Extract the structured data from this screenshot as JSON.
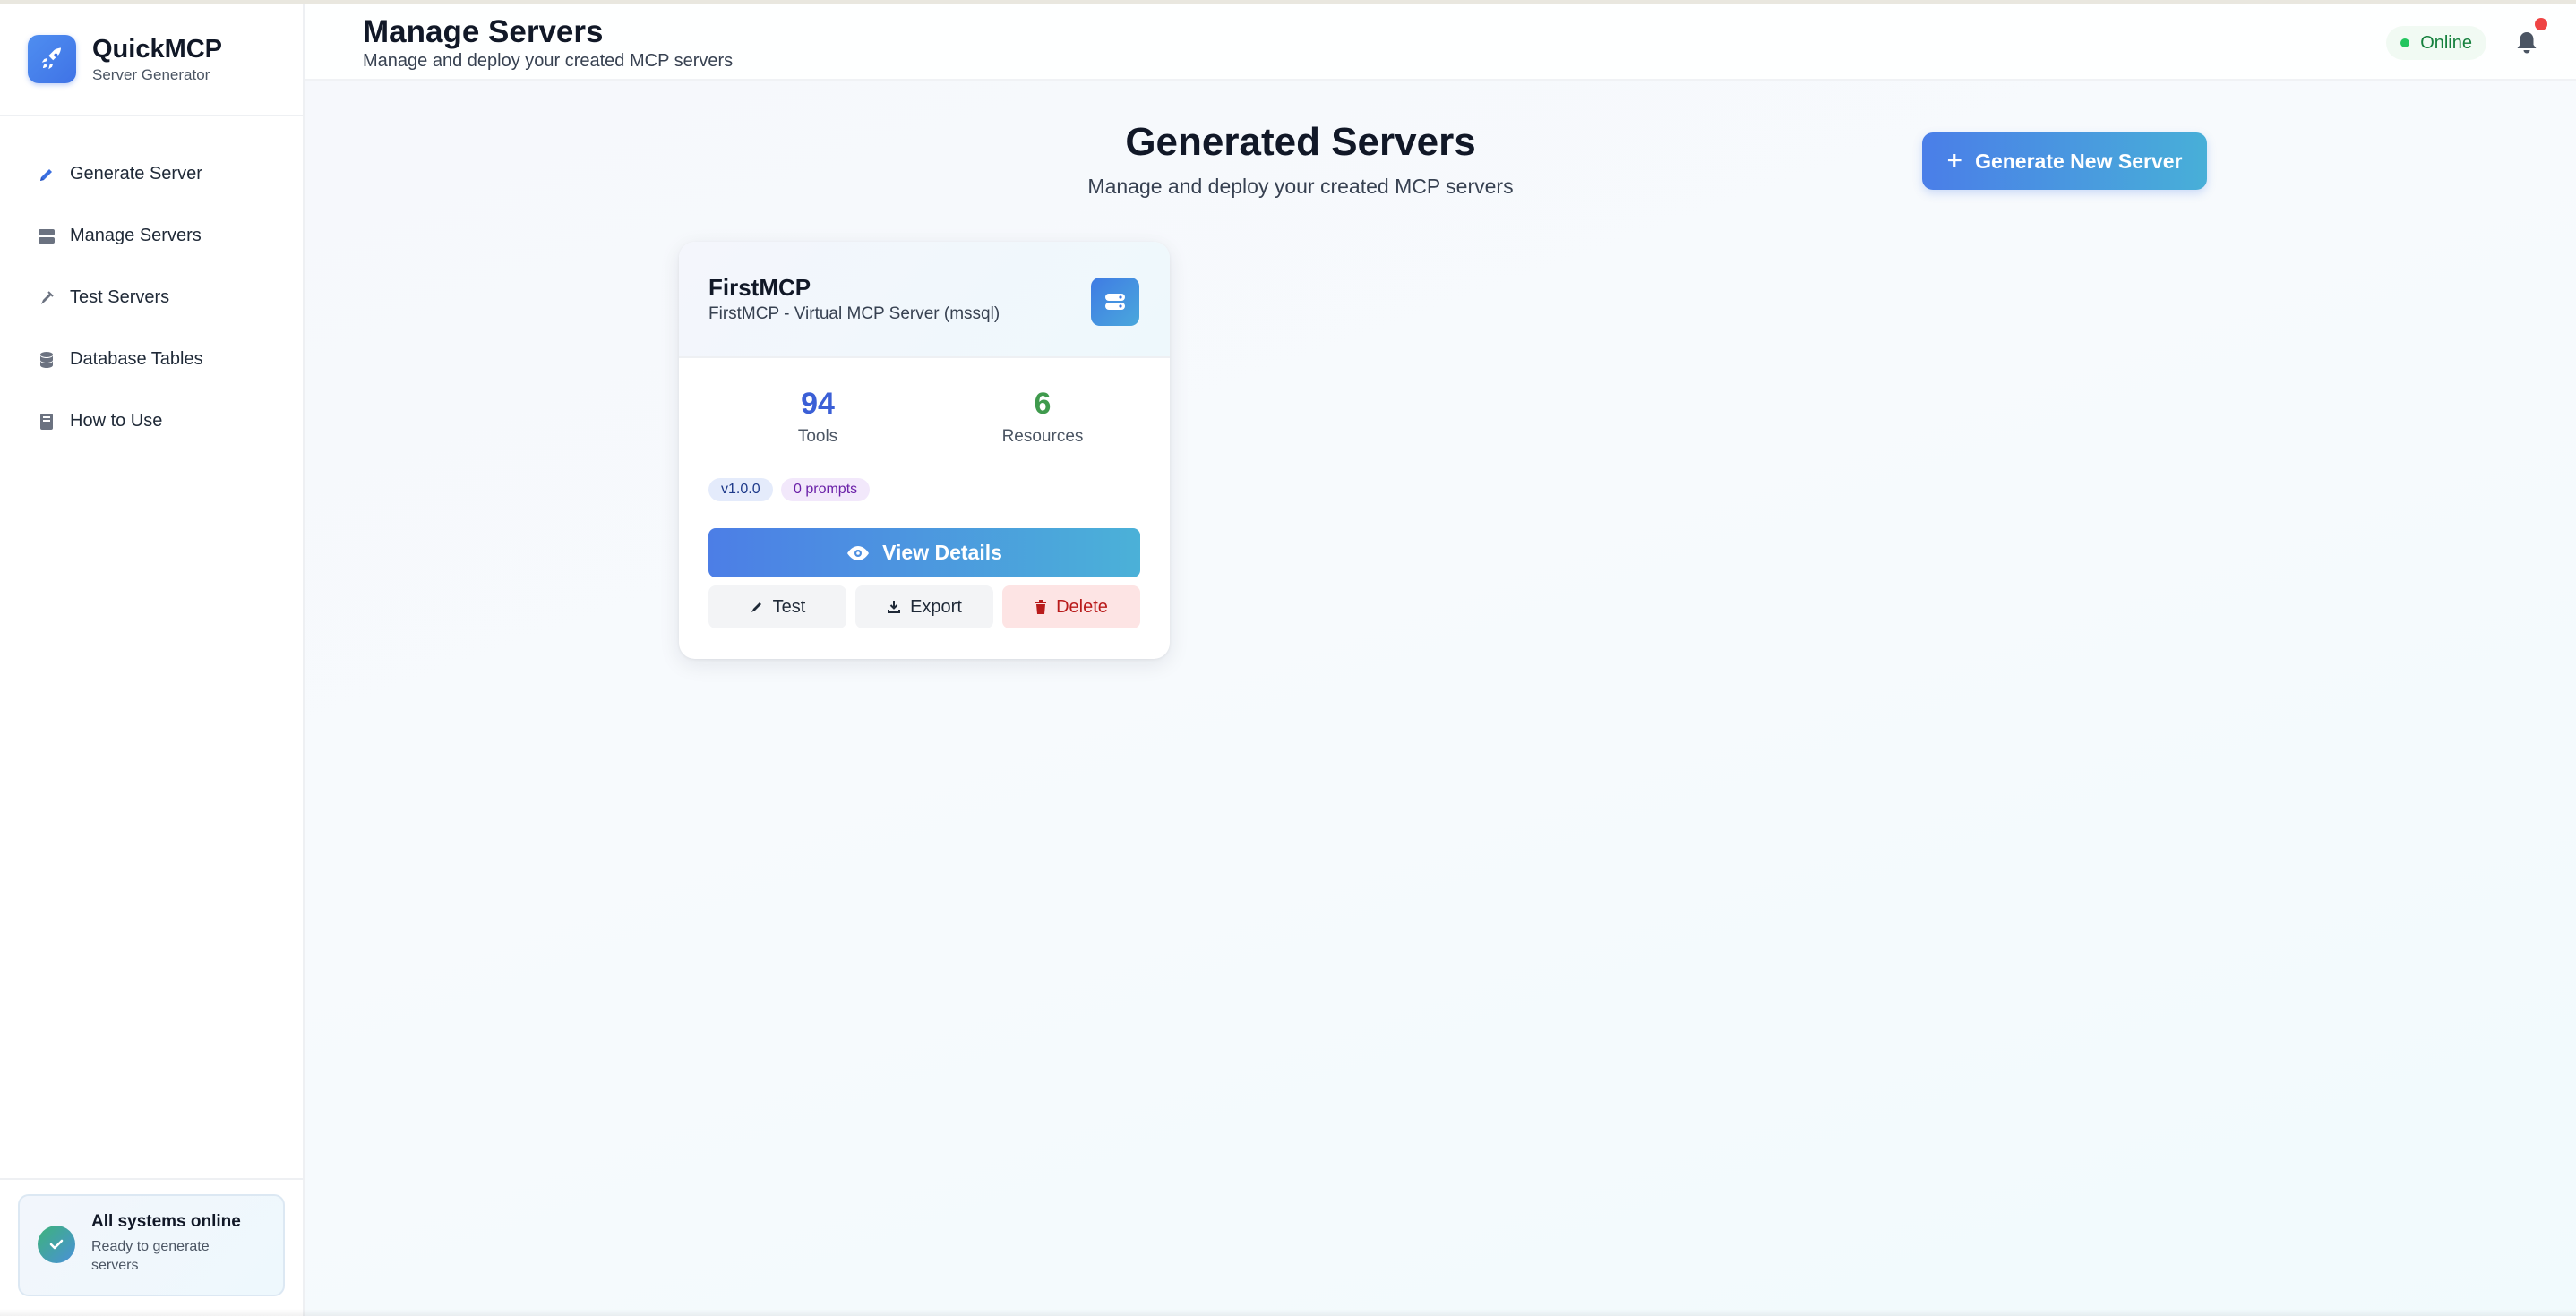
{
  "brand": {
    "name": "QuickMCP",
    "subtitle": "Server Generator"
  },
  "sidebar": {
    "items": [
      {
        "label": "Generate Server",
        "icon": "pencil-icon"
      },
      {
        "label": "Manage Servers",
        "icon": "server-icon"
      },
      {
        "label": "Test Servers",
        "icon": "flask-icon"
      },
      {
        "label": "Database Tables",
        "icon": "database-icon"
      },
      {
        "label": "How to Use",
        "icon": "book-icon"
      }
    ],
    "status": {
      "title": "All systems online",
      "subtitle": "Ready to generate servers"
    }
  },
  "header": {
    "title": "Manage Servers",
    "subtitle": "Manage and deploy your created MCP servers",
    "status": "Online"
  },
  "main": {
    "title": "Generated Servers",
    "subtitle": "Manage and deploy your created MCP servers",
    "generate_button": "Generate New Server"
  },
  "servers": [
    {
      "name": "FirstMCP",
      "description": "FirstMCP - Virtual MCP Server (mssql)",
      "tools_count": "94",
      "tools_label": "Tools",
      "resources_count": "6",
      "resources_label": "Resources",
      "version": "v1.0.0",
      "prompts": "0 prompts",
      "actions": {
        "view": "View Details",
        "test": "Test",
        "export": "Export",
        "delete": "Delete"
      }
    }
  ],
  "colors": {
    "accent": "#4a7ee8",
    "tools": "#3b5fd6",
    "resources": "#3f9a4d",
    "online": "#15803d",
    "danger": "#b91c1c",
    "badge": "#ef4444"
  }
}
